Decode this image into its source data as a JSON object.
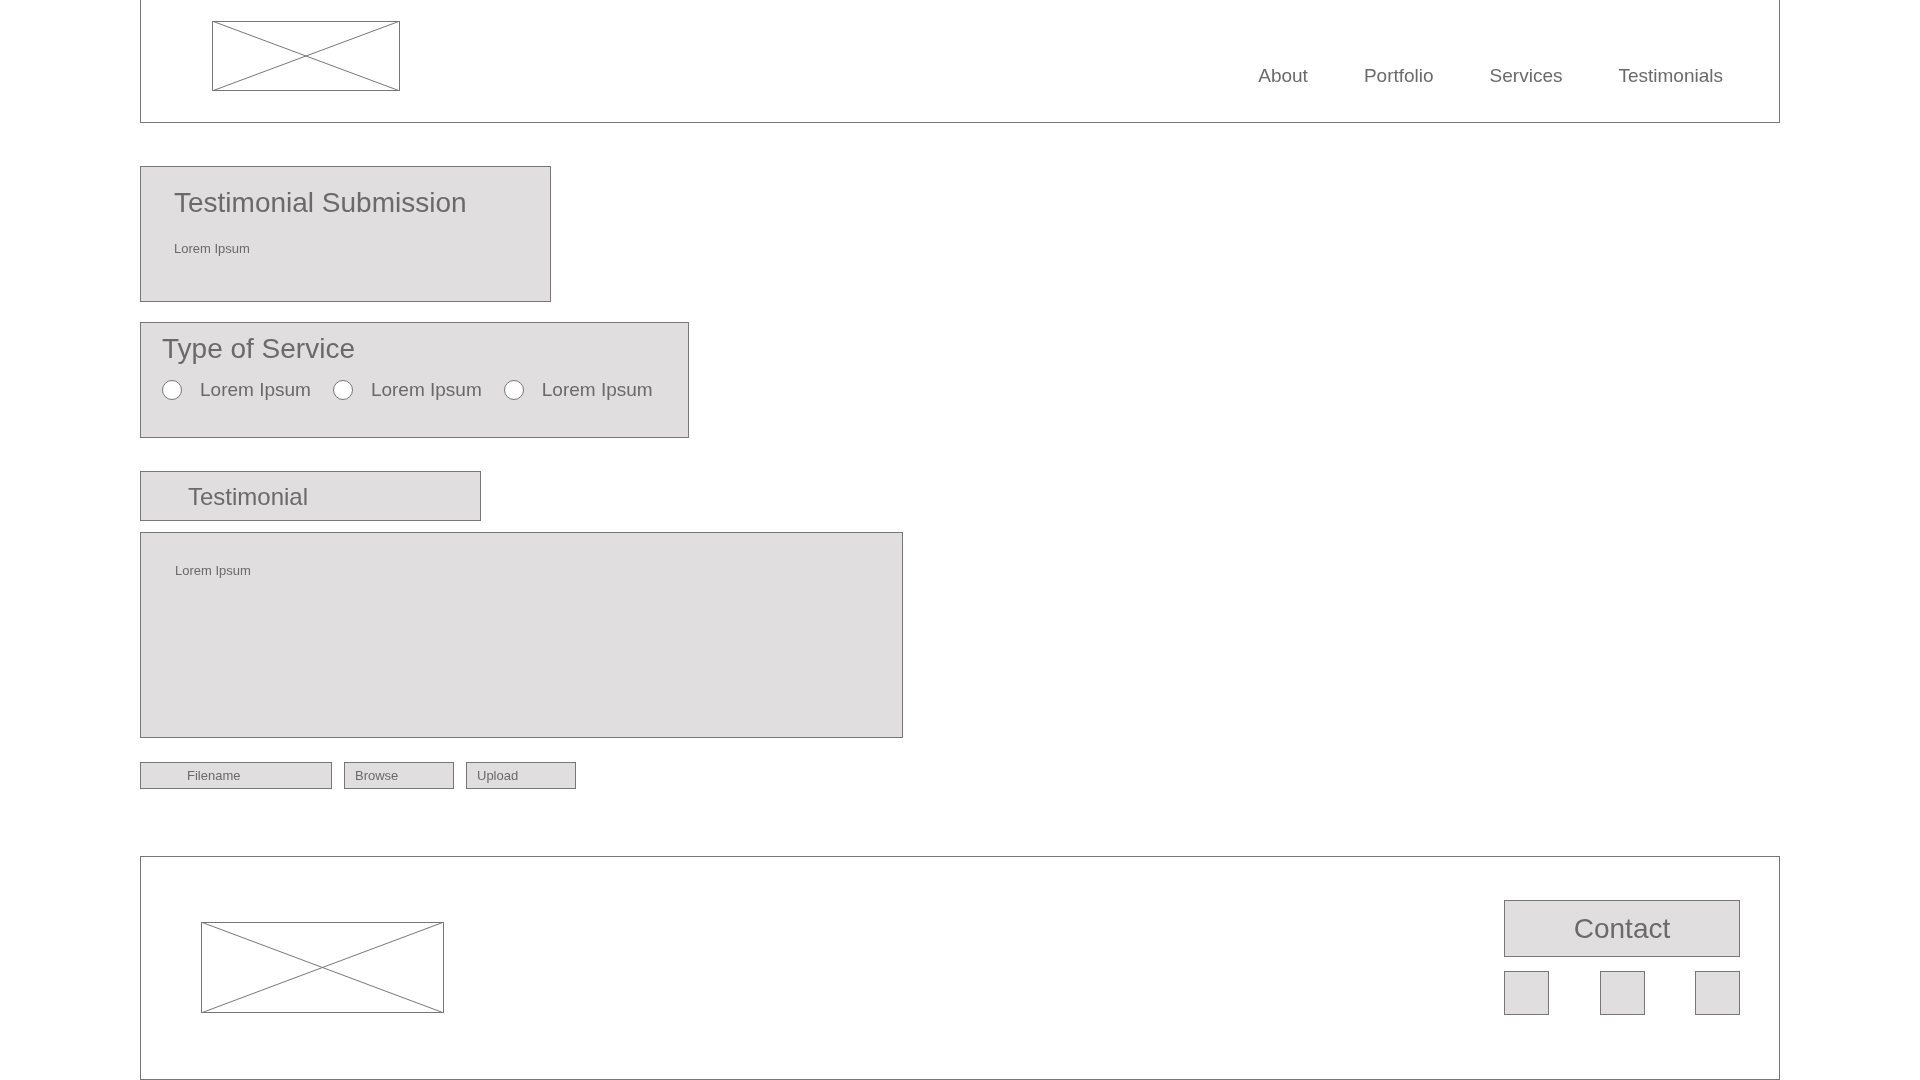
{
  "header": {
    "nav": [
      {
        "label": "About"
      },
      {
        "label": "Portfolio"
      },
      {
        "label": "Services"
      },
      {
        "label": "Testimonials"
      }
    ]
  },
  "intro": {
    "title": "Testimonial Submission",
    "text": "Lorem Ipsum"
  },
  "service": {
    "title": "Type of Service",
    "options": [
      {
        "label": "Lorem Ipsum",
        "selected": false
      },
      {
        "label": "Lorem Ipsum",
        "selected": false
      },
      {
        "label": "Lorem Ipsum",
        "selected": false
      }
    ]
  },
  "testimonial": {
    "label": "Testimonial",
    "placeholder": "Lorem Ipsum"
  },
  "upload": {
    "filename_placeholder": "Filename",
    "buttons": [
      "Browse",
      "Upload"
    ]
  },
  "footer": {
    "contact": "Contact",
    "icons": [
      {
        "kind": "square"
      },
      {
        "kind": "square"
      },
      {
        "kind": "square"
      }
    ]
  }
}
